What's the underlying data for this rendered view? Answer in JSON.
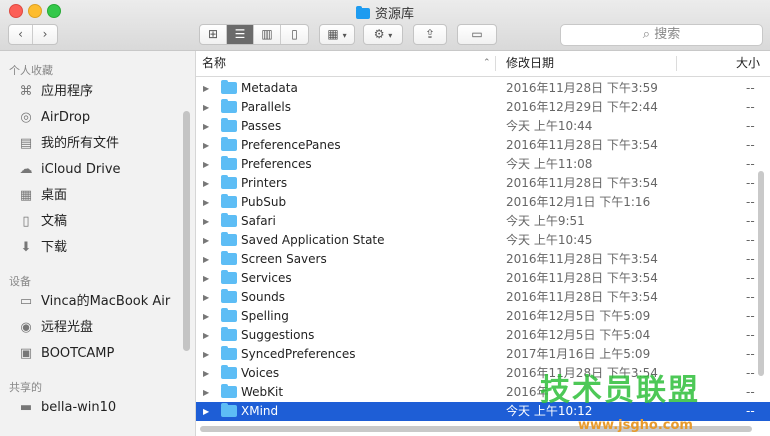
{
  "window": {
    "title": "资源库"
  },
  "toolbar": {
    "back_icon": "chevron-left-icon",
    "forward_icon": "chevron-right-icon",
    "search_placeholder": "搜索"
  },
  "sidebar": {
    "favorites_label": "个人收藏",
    "favorites": [
      {
        "label": "应用程序",
        "icon": "apps-icon"
      },
      {
        "label": "AirDrop",
        "icon": "airdrop-icon"
      },
      {
        "label": "我的所有文件",
        "icon": "files-icon"
      },
      {
        "label": "iCloud Drive",
        "icon": "cloud-icon"
      },
      {
        "label": "桌面",
        "icon": "desktop-icon"
      },
      {
        "label": "文稿",
        "icon": "document-icon"
      },
      {
        "label": "下载",
        "icon": "download-icon"
      }
    ],
    "devices_label": "设备",
    "devices": [
      {
        "label": "Vinca的MacBook Air",
        "icon": "laptop-icon"
      },
      {
        "label": "远程光盘",
        "icon": "disc-icon"
      },
      {
        "label": "BOOTCAMP",
        "icon": "drive-icon"
      }
    ],
    "shared_label": "共享的",
    "shared": [
      {
        "label": "bella-win10",
        "icon": "monitor-icon"
      }
    ]
  },
  "list": {
    "headers": {
      "name": "名称",
      "date": "修改日期",
      "size": "大小"
    },
    "rows": [
      {
        "name": "Metadata",
        "date": "2016年11月28日 下午3:59",
        "size": "--"
      },
      {
        "name": "Parallels",
        "date": "2016年12月29日 下午2:44",
        "size": "--"
      },
      {
        "name": "Passes",
        "date": "今天 上午10:44",
        "size": "--"
      },
      {
        "name": "PreferencePanes",
        "date": "2016年11月28日 下午3:54",
        "size": "--"
      },
      {
        "name": "Preferences",
        "date": "今天 上午11:08",
        "size": "--"
      },
      {
        "name": "Printers",
        "date": "2016年11月28日 下午3:54",
        "size": "--"
      },
      {
        "name": "PubSub",
        "date": "2016年12月1日 下午1:16",
        "size": "--"
      },
      {
        "name": "Safari",
        "date": "今天 上午9:51",
        "size": "--"
      },
      {
        "name": "Saved Application State",
        "date": "今天 上午10:45",
        "size": "--"
      },
      {
        "name": "Screen Savers",
        "date": "2016年11月28日 下午3:54",
        "size": "--"
      },
      {
        "name": "Services",
        "date": "2016年11月28日 下午3:54",
        "size": "--"
      },
      {
        "name": "Sounds",
        "date": "2016年11月28日 下午3:54",
        "size": "--"
      },
      {
        "name": "Spelling",
        "date": "2016年12月5日 下午5:09",
        "size": "--"
      },
      {
        "name": "Suggestions",
        "date": "2016年12月5日 下午5:04",
        "size": "--"
      },
      {
        "name": "SyncedPreferences",
        "date": "2017年1月16日 上午5:09",
        "size": "--"
      },
      {
        "name": "Voices",
        "date": "2016年11月28日 下午3:54",
        "size": "--"
      },
      {
        "name": "WebKit",
        "date": "2016年",
        "size": "--"
      },
      {
        "name": "XMind",
        "date": "今天 上午10:12",
        "size": "--",
        "selected": true
      }
    ]
  },
  "watermark": {
    "main": "技术员联盟",
    "sub": "www.jsgho.com"
  }
}
